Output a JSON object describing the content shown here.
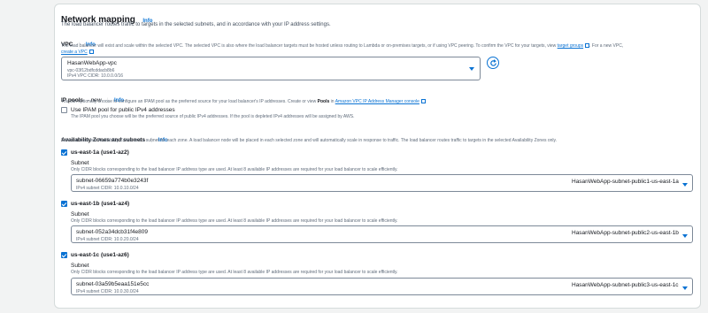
{
  "network": {
    "title": "Network mapping",
    "info": "Info",
    "description": "The load balancer routes traffic to targets in the selected subnets, and in accordance with your IP address settings."
  },
  "vpc": {
    "label": "VPC",
    "info": "Info",
    "description_pre": "The load balancer will exist and scale within the selected VPC. The selected VPC is also where the load balancer targets must be hosted unless routing to Lambda or on-premises targets, or if using VPC peering. To confirm the VPC for your targets, view",
    "target_groups_link": "target groups",
    "description_mid": ". For a new VPC,",
    "create_vpc_link": "create a VPC",
    "selected_name": "HasanWebApp-vpc",
    "selected_id": "vpc-03f12bdfcddacb8b6",
    "selected_cidr": "IPv4 VPC CIDR: 10.0.0.0/16"
  },
  "ip_pools": {
    "label": "IP pools",
    "new_tag": "- new",
    "info": "Info",
    "description_pre": "You can optionally choose to configure an IPAM pool as the preferred source for your load balancer's IP addresses. Create or view",
    "pools_word": "Pools",
    "description_mid": "in",
    "ipam_link": "Amazon VPC IP Address Manager console",
    "checkbox_label": "Use IPAM pool for public IPv4 addresses",
    "checkbox_desc": "The IPAM pool you choose will be the preferred source of public IPv4 addresses. If the pool is depleted IPv4 addresses will be assigned by AWS."
  },
  "az": {
    "label": "Availability Zones and subnets",
    "info": "Info",
    "description": "Select at least two Availability Zones and a subnet for each zone. A load balancer node will be placed in each selected zone and will automatically scale in response to traffic. The load balancer routes traffic to targets in the selected Availability Zones only.",
    "zones": [
      {
        "name": "us-east-1a (use1-az2)",
        "subnet_label": "Subnet",
        "subnet_desc": "Only CIDR blocks corresponding to the load balancer IP address type are used. At least 8 available IP addresses are required for your load balancer to scale efficiently.",
        "subnet_id": "subnet-06659a774b0e3243f",
        "subnet_cidr": "IPv4 subnet CIDR: 10.0.10.0/24",
        "subnet_name": "HasanWebApp-subnet-public1-us-east-1a"
      },
      {
        "name": "us-east-1b (use1-az4)",
        "subnet_label": "Subnet",
        "subnet_desc": "Only CIDR blocks corresponding to the load balancer IP address type are used. At least 8 available IP addresses are required for your load balancer to scale efficiently.",
        "subnet_id": "subnet-052a34dcb31f4e809",
        "subnet_cidr": "IPv4 subnet CIDR: 10.0.20.0/24",
        "subnet_name": "HasanWebApp-subnet-public2-us-east-1b"
      },
      {
        "name": "us-east-1c (use1-az6)",
        "subnet_label": "Subnet",
        "subnet_desc": "Only CIDR blocks corresponding to the load balancer IP address type are used. At least 8 available IP addresses are required for your load balancer to scale efficiently.",
        "subnet_id": "subnet-03a59b5eaa151e5cc",
        "subnet_cidr": "IPv4 subnet CIDR: 10.0.30.0/24",
        "subnet_name": "HasanWebApp-subnet-public3-us-east-1c"
      }
    ]
  },
  "colors": {
    "accent": "#0972d3",
    "text": "#16191f",
    "muted": "#5f6b7a",
    "border": "#7d8998"
  },
  "icons": [
    "external-link-icon",
    "refresh-icon",
    "chevron-down-icon",
    "checkbox-checked-icon"
  ]
}
